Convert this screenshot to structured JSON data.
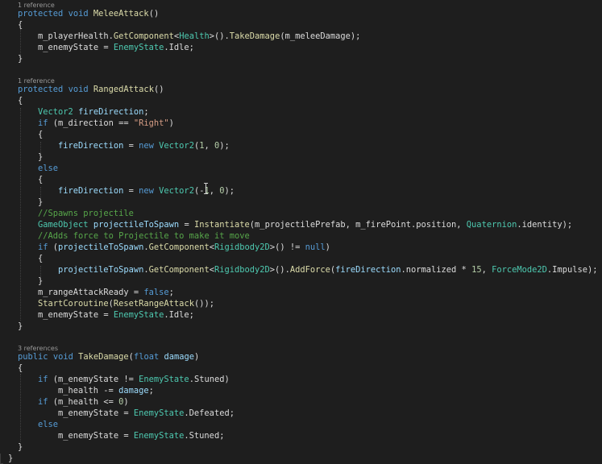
{
  "code_lines": [
    {
      "lens": "1 reference"
    },
    {
      "indent": 0,
      "tokens": [
        [
          "kw",
          "protected"
        ],
        [
          "p",
          " "
        ],
        [
          "kw",
          "void"
        ],
        [
          "p",
          " "
        ],
        [
          "fn",
          "MeleeAttack"
        ],
        [
          "p",
          "()"
        ]
      ]
    },
    {
      "indent": 0,
      "tokens": [
        [
          "p",
          "{"
        ]
      ]
    },
    {
      "indent": 1,
      "tokens": [
        [
          "p",
          "m_playerHealth."
        ],
        [
          "fn",
          "GetComponent"
        ],
        [
          "p",
          "<"
        ],
        [
          "ty",
          "Health"
        ],
        [
          "p",
          ">()."
        ],
        [
          "fn",
          "TakeDamage"
        ],
        [
          "p",
          "(m_meleeDamage);"
        ]
      ]
    },
    {
      "indent": 1,
      "tokens": [
        [
          "p",
          "m_enemyState = "
        ],
        [
          "ty",
          "EnemyState"
        ],
        [
          "p",
          ".Idle;"
        ]
      ]
    },
    {
      "indent": 0,
      "tokens": [
        [
          "p",
          "}"
        ]
      ]
    },
    {
      "blank": true
    },
    {
      "lens": "1 reference"
    },
    {
      "indent": 0,
      "tokens": [
        [
          "kw",
          "protected"
        ],
        [
          "p",
          " "
        ],
        [
          "kw",
          "void"
        ],
        [
          "p",
          " "
        ],
        [
          "fn",
          "RangedAttack"
        ],
        [
          "p",
          "()"
        ]
      ]
    },
    {
      "indent": 0,
      "tokens": [
        [
          "p",
          "{"
        ]
      ]
    },
    {
      "indent": 1,
      "tokens": [
        [
          "ty",
          "Vector2"
        ],
        [
          "p",
          " "
        ],
        [
          "pm",
          "fireDirection"
        ],
        [
          "p",
          ";"
        ]
      ]
    },
    {
      "indent": 1,
      "tokens": [
        [
          "kw",
          "if"
        ],
        [
          "p",
          " (m_direction == "
        ],
        [
          "str",
          "\"Right\""
        ],
        [
          "p",
          ")"
        ]
      ]
    },
    {
      "indent": 1,
      "tokens": [
        [
          "p",
          "{"
        ]
      ]
    },
    {
      "indent": 2,
      "tokens": [
        [
          "pm",
          "fireDirection"
        ],
        [
          "p",
          " = "
        ],
        [
          "kw",
          "new"
        ],
        [
          "p",
          " "
        ],
        [
          "ty",
          "Vector2"
        ],
        [
          "p",
          "("
        ],
        [
          "num",
          "1"
        ],
        [
          "p",
          ", "
        ],
        [
          "num",
          "0"
        ],
        [
          "p",
          ");"
        ]
      ]
    },
    {
      "indent": 1,
      "tokens": [
        [
          "p",
          "}"
        ]
      ]
    },
    {
      "indent": 1,
      "tokens": [
        [
          "kw",
          "else"
        ]
      ]
    },
    {
      "indent": 1,
      "tokens": [
        [
          "p",
          "{"
        ]
      ]
    },
    {
      "indent": 2,
      "tokens": [
        [
          "pm",
          "fireDirection"
        ],
        [
          "p",
          " = "
        ],
        [
          "kw",
          "new"
        ],
        [
          "p",
          " "
        ],
        [
          "ty",
          "Vector2"
        ],
        [
          "p",
          "(-"
        ],
        [
          "num",
          "1"
        ],
        [
          "p",
          ", "
        ],
        [
          "num",
          "0"
        ],
        [
          "p",
          ");"
        ]
      ]
    },
    {
      "indent": 1,
      "tokens": [
        [
          "p",
          "}"
        ]
      ]
    },
    {
      "indent": 1,
      "tokens": [
        [
          "cm",
          "//Spawns projectile"
        ]
      ]
    },
    {
      "indent": 1,
      "tokens": [
        [
          "ty",
          "GameObject"
        ],
        [
          "p",
          " "
        ],
        [
          "pm",
          "projectileToSpawn"
        ],
        [
          "p",
          " = "
        ],
        [
          "fn",
          "Instantiate"
        ],
        [
          "p",
          "(m_projectilePrefab, m_firePoint.position, "
        ],
        [
          "ty",
          "Quaternion"
        ],
        [
          "p",
          ".identity);"
        ]
      ]
    },
    {
      "indent": 1,
      "tokens": [
        [
          "cm",
          "//Adds force to Projectile to make it move"
        ]
      ]
    },
    {
      "indent": 1,
      "tokens": [
        [
          "kw",
          "if"
        ],
        [
          "p",
          " ("
        ],
        [
          "pm",
          "projectileToSpawn"
        ],
        [
          "p",
          "."
        ],
        [
          "fn",
          "GetComponent"
        ],
        [
          "p",
          "<"
        ],
        [
          "ty",
          "Rigidbody2D"
        ],
        [
          "p",
          ">() != "
        ],
        [
          "kw",
          "null"
        ],
        [
          "p",
          ")"
        ]
      ]
    },
    {
      "indent": 1,
      "tokens": [
        [
          "p",
          "{"
        ]
      ]
    },
    {
      "indent": 2,
      "tokens": [
        [
          "pm",
          "projectileToSpawn"
        ],
        [
          "p",
          "."
        ],
        [
          "fn",
          "GetComponent"
        ],
        [
          "p",
          "<"
        ],
        [
          "ty",
          "Rigidbody2D"
        ],
        [
          "p",
          ">()."
        ],
        [
          "fn",
          "AddForce"
        ],
        [
          "p",
          "("
        ],
        [
          "pm",
          "fireDirection"
        ],
        [
          "p",
          ".normalized * "
        ],
        [
          "num",
          "15"
        ],
        [
          "p",
          ", "
        ],
        [
          "ty",
          "ForceMode2D"
        ],
        [
          "p",
          ".Impulse);"
        ]
      ]
    },
    {
      "indent": 1,
      "tokens": [
        [
          "p",
          "}"
        ]
      ]
    },
    {
      "indent": 1,
      "tokens": [
        [
          "p",
          "m_rangeAttackReady = "
        ],
        [
          "kw",
          "false"
        ],
        [
          "p",
          ";"
        ]
      ]
    },
    {
      "indent": 1,
      "tokens": [
        [
          "fn",
          "StartCoroutine"
        ],
        [
          "p",
          "("
        ],
        [
          "fn",
          "ResetRangeAttack"
        ],
        [
          "p",
          "());"
        ]
      ]
    },
    {
      "indent": 1,
      "tokens": [
        [
          "p",
          "m_enemyState = "
        ],
        [
          "ty",
          "EnemyState"
        ],
        [
          "p",
          ".Idle;"
        ]
      ]
    },
    {
      "indent": 0,
      "tokens": [
        [
          "p",
          "}"
        ]
      ]
    },
    {
      "blank": true
    },
    {
      "lens": "3 references"
    },
    {
      "indent": 0,
      "tokens": [
        [
          "kw",
          "public"
        ],
        [
          "p",
          " "
        ],
        [
          "kw",
          "void"
        ],
        [
          "p",
          " "
        ],
        [
          "fn",
          "TakeDamage"
        ],
        [
          "p",
          "("
        ],
        [
          "kw",
          "float"
        ],
        [
          "p",
          " "
        ],
        [
          "pm",
          "damage"
        ],
        [
          "p",
          ")"
        ]
      ]
    },
    {
      "indent": 0,
      "tokens": [
        [
          "p",
          "{"
        ]
      ]
    },
    {
      "indent": 1,
      "tokens": [
        [
          "kw",
          "if"
        ],
        [
          "p",
          " (m_enemyState != "
        ],
        [
          "ty",
          "EnemyState"
        ],
        [
          "p",
          ".Stuned)"
        ]
      ]
    },
    {
      "indent": 2,
      "tokens": [
        [
          "p",
          "m_health -= "
        ],
        [
          "pm",
          "damage"
        ],
        [
          "p",
          ";"
        ]
      ]
    },
    {
      "indent": 1,
      "tokens": [
        [
          "kw",
          "if"
        ],
        [
          "p",
          " (m_health <= "
        ],
        [
          "num",
          "0"
        ],
        [
          "p",
          ")"
        ]
      ]
    },
    {
      "indent": 2,
      "tokens": [
        [
          "p",
          "m_enemyState = "
        ],
        [
          "ty",
          "EnemyState"
        ],
        [
          "p",
          ".Defeated;"
        ]
      ]
    },
    {
      "indent": 1,
      "tokens": [
        [
          "kw",
          "else"
        ]
      ]
    },
    {
      "indent": 2,
      "tokens": [
        [
          "p",
          "m_enemyState = "
        ],
        [
          "ty",
          "EnemyState"
        ],
        [
          "p",
          ".Stuned;"
        ]
      ]
    },
    {
      "indent": 0,
      "tokens": [
        [
          "p",
          "}"
        ]
      ]
    },
    {
      "indent": -1,
      "tokens": [
        [
          "p",
          "}"
        ]
      ]
    }
  ]
}
